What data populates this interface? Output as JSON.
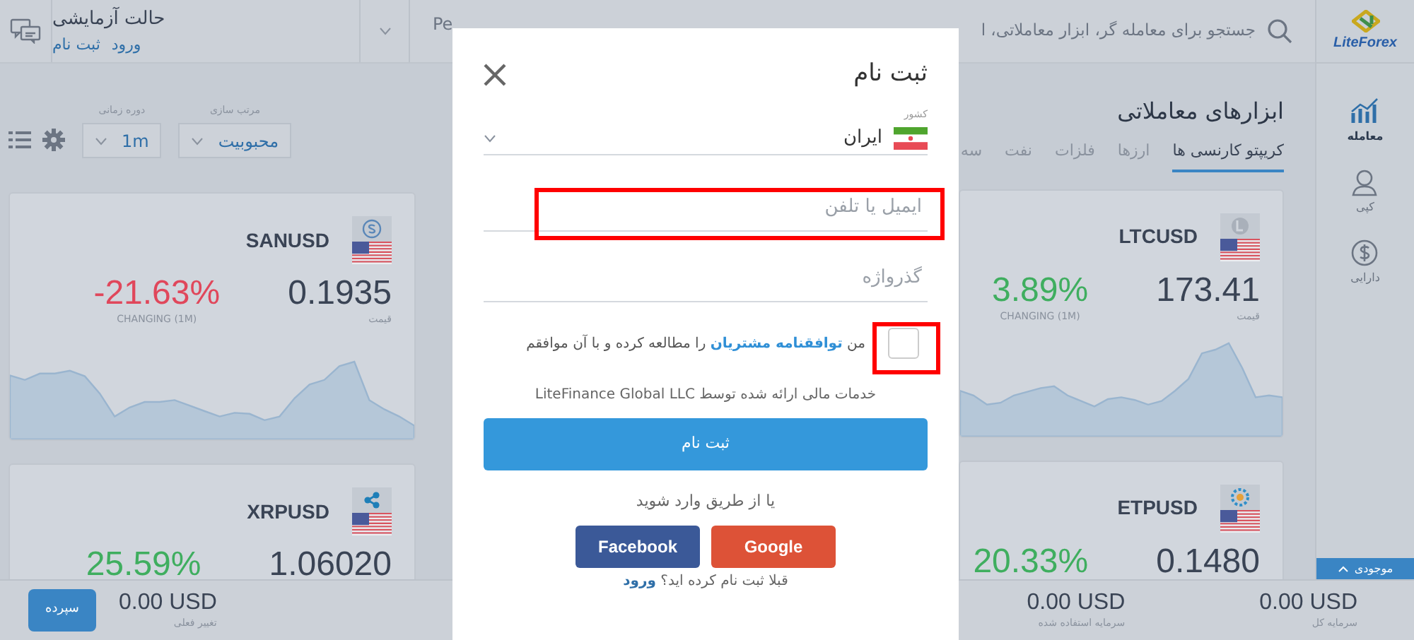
{
  "header": {
    "demo_title": "حالت آزمایشی",
    "demo_links": [
      {
        "label": "ورود"
      },
      {
        "label": "ثبت نام"
      }
    ],
    "header_text": "Pe",
    "search": {
      "placeholder": "جستجو برای معامله گر، ابزار معاملاتی، ا"
    }
  },
  "sidebar": {
    "logo": "LiteForex",
    "items": [
      {
        "label": "معامله",
        "selected": true
      },
      {
        "label": "کپی",
        "selected": false
      },
      {
        "label": "دارایی",
        "selected": false
      }
    ],
    "balance_tab": "موجودی"
  },
  "toolbar": {
    "timeframe": {
      "label": "دوره زمانی",
      "value": "1m"
    },
    "sort": {
      "label": "مرتب سازی",
      "value": "محبوبیت"
    }
  },
  "title": "ابزارهای معاملاتی",
  "tabs": [
    {
      "label": "کریپتو کارنسی ها",
      "selected": true
    },
    {
      "label": "ارزها",
      "selected": false
    },
    {
      "label": "فلزات",
      "selected": false
    },
    {
      "label": "نفت",
      "selected": false
    },
    {
      "label": "سه",
      "selected": false
    }
  ],
  "cards_right": [
    {
      "symbol": "LTCUSD",
      "price": "173.41",
      "price_label": "قیمت",
      "change": "3.89%",
      "change_label": "CHANGING (1M)",
      "color": "#3fae5f"
    },
    {
      "symbol": "ETPUSD",
      "price": "0.1480",
      "change": "20.33%",
      "color": "#3fae5f"
    }
  ],
  "cards_left": [
    {
      "symbol": "SANUSD",
      "price": "0.1935",
      "price_label": "قیمت",
      "change": "-21.63%",
      "change_label": "CHANGING (1M)",
      "color": "#e0475b"
    },
    {
      "symbol": "XRPUSD",
      "price": "1.06020",
      "change": "25.59%",
      "color": "#3fae5f"
    }
  ],
  "bottom_bar": {
    "deposit_button": "سپرده",
    "stats": [
      {
        "value": "0.00 USD",
        "label": "سرمایه کل"
      },
      {
        "value": "0.00 USD",
        "label": "سرمایه استفاده شده"
      },
      {
        "value": "0.00 USD",
        "label": "تغییر فعلی"
      }
    ]
  },
  "modal": {
    "title": "ثبت نام",
    "country": {
      "label": "کشور",
      "value": "ایران"
    },
    "email": {
      "placeholder": "ایمیل یا تلفن"
    },
    "password": {
      "placeholder": "گذرواژه"
    },
    "agreement": {
      "checked": false,
      "before": "من",
      "link": "توافقنامه مشتریان",
      "after": "را مطالعه کرده و با آن موافقم"
    },
    "provider_note": "خدمات مالی ارائه شده توسط LiteFinance Global LLC",
    "submit": "ثبت نام",
    "social_prompt": "یا از طریق وارد شوید",
    "social_buttons": [
      {
        "label": "Google",
        "kind": "google"
      },
      {
        "label": "Facebook",
        "kind": "facebook"
      }
    ],
    "login_prompt": "قبلا ثبت نام کرده اید؟",
    "login_link": "ورود"
  }
}
